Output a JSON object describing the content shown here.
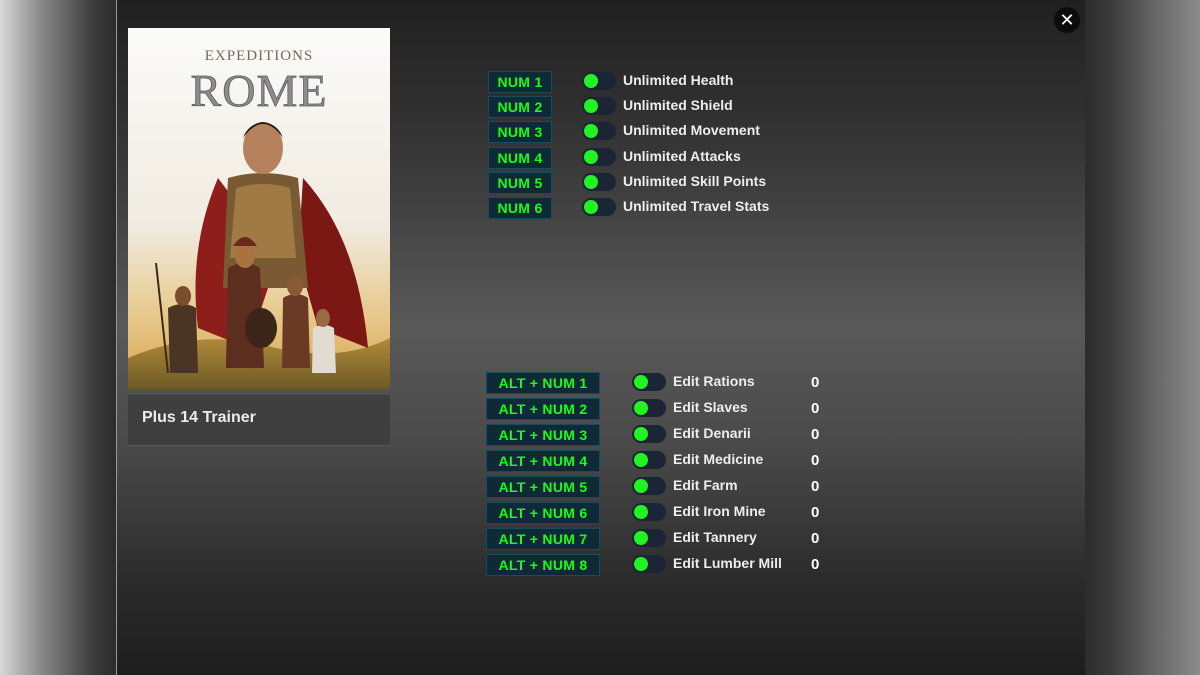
{
  "window": {
    "close_glyph": "✕",
    "close_icon": "close-icon"
  },
  "cover": {
    "title_line1": "EXPEDITIONS",
    "title_line2": "ROME"
  },
  "trainer_label": "Plus 14 Trainer",
  "cheats": [
    {
      "key": "NUM 1",
      "label": "Unlimited Health",
      "enabled": false
    },
    {
      "key": "NUM 2",
      "label": "Unlimited Shield",
      "enabled": false
    },
    {
      "key": "NUM 3",
      "label": "Unlimited Movement",
      "enabled": false
    },
    {
      "key": "NUM 4",
      "label": "Unlimited Attacks",
      "enabled": false
    },
    {
      "key": "NUM 5",
      "label": "Unlimited Skill Points",
      "enabled": false
    },
    {
      "key": "NUM 6",
      "label": "Unlimited Travel Stats",
      "enabled": false
    }
  ],
  "edits": [
    {
      "key": "ALT + NUM 1",
      "label": "Edit Rations",
      "value": "0",
      "enabled": false
    },
    {
      "key": "ALT + NUM 2",
      "label": "Edit Slaves",
      "value": "0",
      "enabled": false
    },
    {
      "key": "ALT + NUM 3",
      "label": "Edit Denarii",
      "value": "0",
      "enabled": false
    },
    {
      "key": "ALT + NUM 4",
      "label": "Edit Medicine",
      "value": "0",
      "enabled": false
    },
    {
      "key": "ALT + NUM 5",
      "label": "Edit Farm",
      "value": "0",
      "enabled": false
    },
    {
      "key": "ALT + NUM 6",
      "label": "Edit Iron Mine",
      "value": "0",
      "enabled": false
    },
    {
      "key": "ALT + NUM 7",
      "label": "Edit Tannery",
      "value": "0",
      "enabled": false
    },
    {
      "key": "ALT + NUM 8",
      "label": "Edit Lumber Mill",
      "value": "0",
      "enabled": false
    }
  ],
  "colors": {
    "hotkey_text": "#17ff17",
    "hotkey_bg": "#0e2a36",
    "toggle_knob": "#22f322",
    "toggle_track": "#1b2535"
  }
}
